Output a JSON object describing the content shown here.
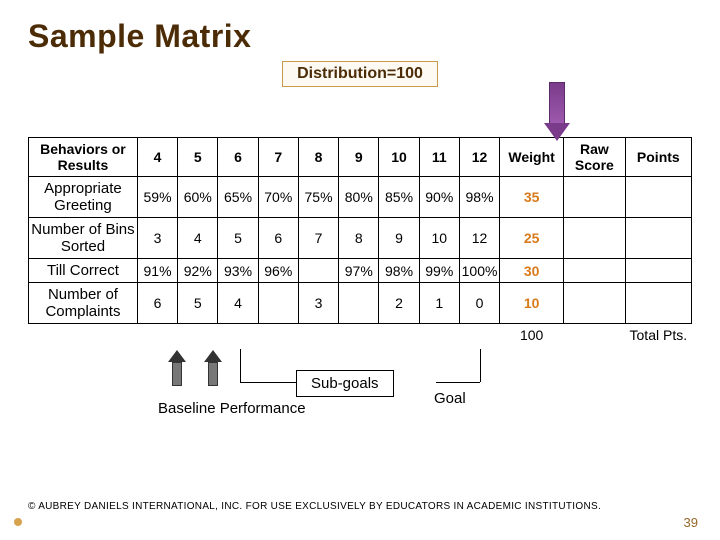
{
  "title": "Sample Matrix",
  "distribution_label": "Distribution=100",
  "headers": {
    "behaviors": "Behaviors or Results",
    "cols": [
      "4",
      "5",
      "6",
      "7",
      "8",
      "9",
      "10",
      "11",
      "12"
    ],
    "weight": "Weight",
    "raw": "Raw Score",
    "points": "Points"
  },
  "rows": [
    {
      "label": "Appropriate Greeting",
      "cells": [
        "59%",
        "60%",
        "65%",
        "70%",
        "75%",
        "80%",
        "85%",
        "90%",
        "98%"
      ],
      "weight": "35",
      "raw": "",
      "points": ""
    },
    {
      "label": "Number of Bins Sorted",
      "cells": [
        "3",
        "4",
        "5",
        "6",
        "7",
        "8",
        "9",
        "10",
        "12"
      ],
      "weight": "25",
      "raw": "",
      "points": ""
    },
    {
      "label": "Till Correct",
      "cells": [
        "91%",
        "92%",
        "93%",
        "96%",
        "",
        "97%",
        "98%",
        "99%",
        "100%"
      ],
      "weight": "30",
      "raw": "",
      "points": ""
    },
    {
      "label": "Number of Complaints",
      "cells": [
        "6",
        "5",
        "4",
        "",
        "3",
        "",
        "2",
        "1",
        "0"
      ],
      "weight": "10",
      "raw": "",
      "points": ""
    }
  ],
  "weight_total": "100",
  "total_points_label": "Total Pts.",
  "annotations": {
    "subgoals": "Sub-goals",
    "baseline": "Baseline Performance",
    "goal": "Goal"
  },
  "copyright": "© AUBREY DANIELS INTERNATIONAL, INC. FOR USE EXCLUSIVELY BY EDUCATORS IN ACADEMIC INSTITUTIONS.",
  "page_number": "39",
  "chart_data": {
    "type": "table",
    "title": "Sample Matrix — performance matrix with weights",
    "columns": [
      "Behaviors or Results",
      "4",
      "5",
      "6",
      "7",
      "8",
      "9",
      "10",
      "11",
      "12",
      "Weight",
      "Raw Score",
      "Points"
    ],
    "rows": [
      [
        "Appropriate Greeting",
        "59%",
        "60%",
        "65%",
        "70%",
        "75%",
        "80%",
        "85%",
        "90%",
        "98%",
        35,
        null,
        null
      ],
      [
        "Number of Bins Sorted",
        3,
        4,
        5,
        6,
        7,
        8,
        9,
        10,
        12,
        25,
        null,
        null
      ],
      [
        "Till Correct",
        "91%",
        "92%",
        "93%",
        "96%",
        null,
        "97%",
        "98%",
        "99%",
        "100%",
        30,
        null,
        null
      ],
      [
        "Number of Complaints",
        6,
        5,
        4,
        null,
        3,
        null,
        2,
        1,
        0,
        10,
        null,
        null
      ]
    ],
    "weight_total": 100,
    "annotations": [
      "Distribution=100",
      "Baseline Performance at cols 5–6",
      "Sub-goals at col 7",
      "Goal at col 11"
    ]
  }
}
